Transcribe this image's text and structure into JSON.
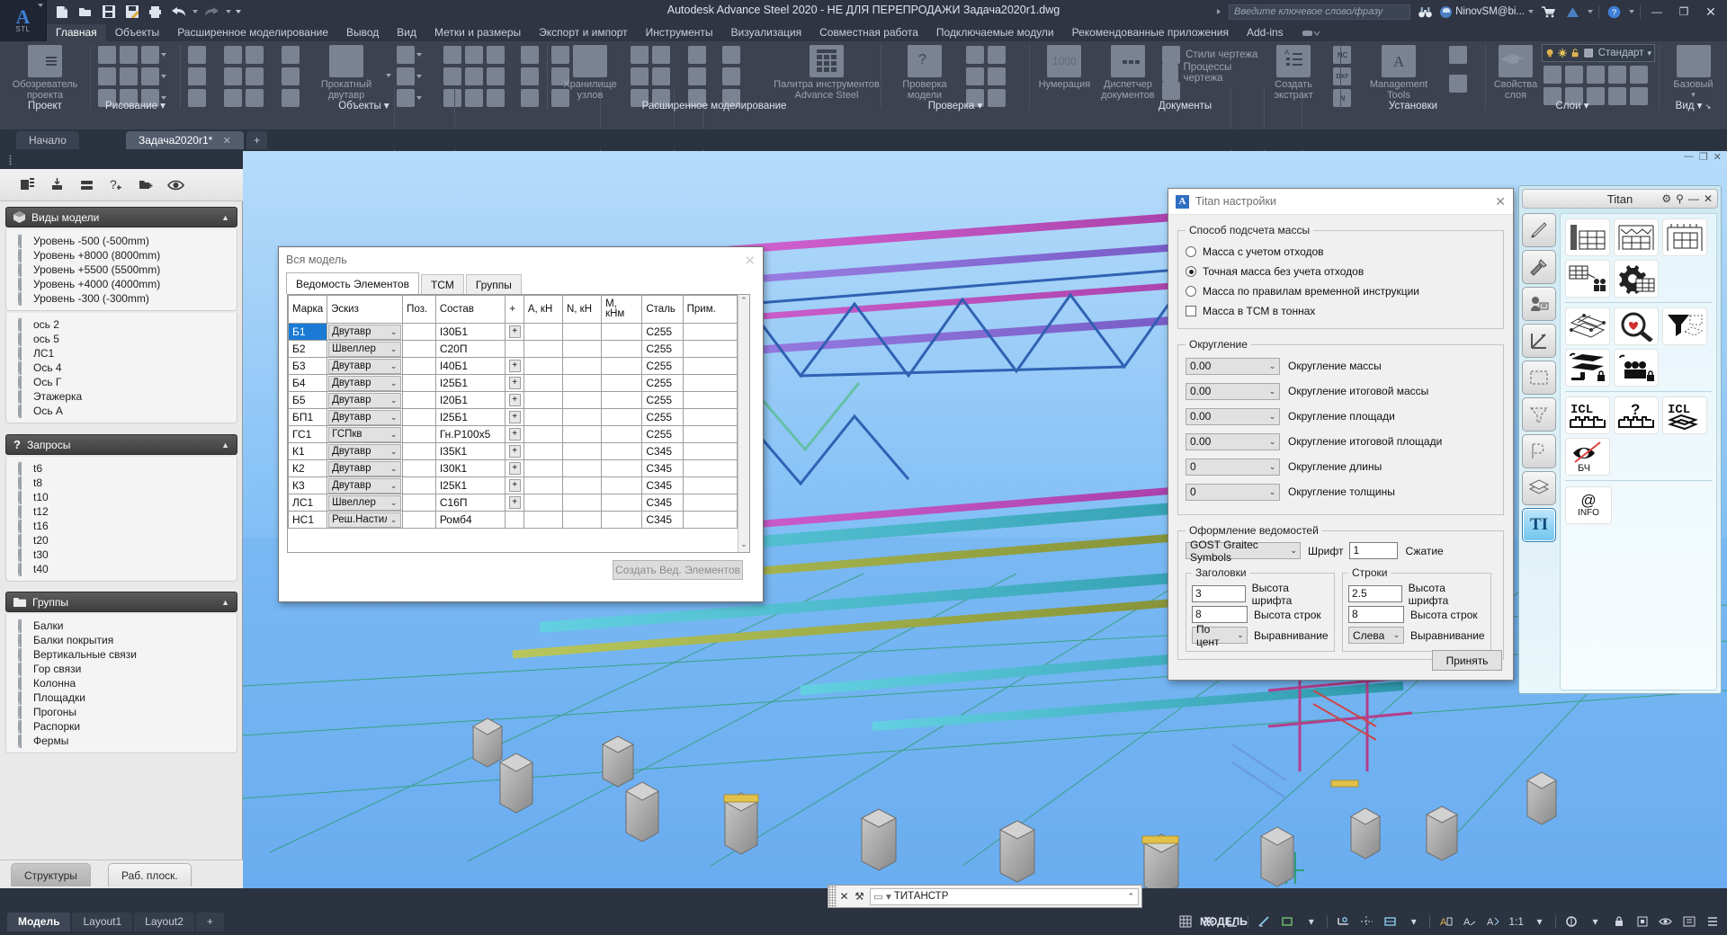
{
  "titlebar": {
    "app_title": "Autodesk Advance Steel 2020 - НЕ ДЛЯ ПЕРЕПРОДАЖИ    Задача2020r1.dwg",
    "app_button_label": "STL",
    "search_placeholder": "Введите ключевое слово/фразу",
    "user_name": "NinovSM@bi...",
    "quick_access": [
      {
        "name": "new-icon",
        "glyph": "🗋"
      },
      {
        "name": "open-icon",
        "glyph": "🗁"
      },
      {
        "name": "save-icon",
        "glyph": "🖫"
      },
      {
        "name": "save-as-icon",
        "glyph": "🖫"
      },
      {
        "name": "plot-icon",
        "glyph": "🖶"
      },
      {
        "name": "undo-icon",
        "glyph": "↰"
      },
      {
        "name": "redo-icon",
        "glyph": "↱"
      }
    ],
    "window_buttons": {
      "minimize": "—",
      "restore": "❐",
      "close": "✕"
    },
    "help_glyph": "?",
    "cart_glyph": "🛒"
  },
  "ribbon": {
    "tabs": [
      {
        "label": "Главная",
        "active": true
      },
      {
        "label": "Объекты",
        "active": false
      },
      {
        "label": "Расширенное моделирование",
        "active": false
      },
      {
        "label": "Вывод",
        "active": false
      },
      {
        "label": "Вид",
        "active": false
      },
      {
        "label": "Метки и размеры",
        "active": false
      },
      {
        "label": "Экспорт и импорт",
        "active": false
      },
      {
        "label": "Инструменты",
        "active": false
      },
      {
        "label": "Визуализация",
        "active": false
      },
      {
        "label": "Совместная работа",
        "active": false
      },
      {
        "label": "Подключаемые модули",
        "active": false
      },
      {
        "label": "Рекомендованные приложения",
        "active": false
      },
      {
        "label": "Add-ins",
        "active": false
      }
    ],
    "panels": [
      {
        "name": "Проект",
        "big_label": "Обозреватель\nпроекта"
      },
      {
        "name": "Рисование",
        "big_label": ""
      },
      {
        "name": "Объекты",
        "big_label": "Прокатный\nдвутавр"
      },
      {
        "name": "Расширенное моделирование",
        "big_label1": "Хранилище\nузлов",
        "big_label2": "Палитра инструментов\nAdvance Steel"
      },
      {
        "name": "Проверка",
        "big_label": "Проверка\nмодели"
      },
      {
        "name": "Документы",
        "big_label1": "Нумерация",
        "big_label2": "Диспетчер\nдокументов",
        "big_label3": "Создать\nэкстракт",
        "items": [
          "Стили чертежа",
          "Процессы чертежа"
        ],
        "numeration_value": "1000"
      },
      {
        "name": "Установки",
        "big_label": "Management\nTools"
      },
      {
        "name": "Слои",
        "big_label": "Свойства\nслоя",
        "layer_name": "Стандарт"
      },
      {
        "name": "Вид",
        "big_label": "Базовый"
      }
    ],
    "nc_labels": [
      "NC",
      "DXF",
      "N"
    ]
  },
  "file_tabs": [
    {
      "label": "Начало",
      "active": false,
      "closable": false
    },
    {
      "label": "Задача2020r1*",
      "active": true,
      "closable": true
    },
    {
      "label": "+",
      "active": false,
      "closable": false
    }
  ],
  "left_panel": {
    "toolbar_icons": [
      "list-icon",
      "add-model-view-icon",
      "layers-icon",
      "query-add-icon",
      "folder-add-icon",
      "visibility-icon"
    ],
    "groups": [
      {
        "title": "Виды модели",
        "icon": "cube-icon",
        "collapsed": false,
        "sections": [
          {
            "items": [
              "Уровень -500 (-500mm)",
              "Уровень +8000 (8000mm)",
              "Уровень +5500 (5500mm)",
              "Уровень +4000 (4000mm)",
              "Уровень -300 (-300mm)"
            ]
          },
          {
            "items": [
              "ось 2",
              "ось 5",
              "ЛС1",
              "Ось 4",
              "Ось Г",
              "Этажерка",
              "Ось А"
            ]
          }
        ]
      },
      {
        "title": "Запросы",
        "icon": "question-icon",
        "collapsed": false,
        "sections": [
          {
            "items": [
              "t6",
              "t8",
              "t10",
              "t12",
              "t16",
              "t20",
              "t30",
              "t40"
            ]
          }
        ]
      },
      {
        "title": "Группы",
        "icon": "folder-icon",
        "collapsed": false,
        "sections": [
          {
            "items": [
              "Балки",
              "Балки покрытия",
              "Вертикальные связи",
              "Гор связи",
              "Колонна",
              "Площадки",
              "Прогоны",
              "Распорки",
              "Фермы"
            ]
          }
        ]
      }
    ],
    "bottom_tabs": [
      {
        "label": "Структуры",
        "selected": true
      },
      {
        "label": "Раб. плоск.",
        "selected": false
      }
    ]
  },
  "table_dialog": {
    "title": "Вся модель",
    "close_glyph": "✕",
    "tabs": [
      {
        "label": "Ведомость Элементов",
        "selected": true
      },
      {
        "label": "ТСМ",
        "selected": false
      },
      {
        "label": "Группы",
        "selected": false
      }
    ],
    "columns": [
      "Марка",
      "Эскиз",
      "Поз.",
      "Состав",
      "+",
      "A, кН",
      "N, кН",
      "M, кНм",
      "Сталь",
      "Прим."
    ],
    "rows": [
      {
        "marka": "Б1",
        "eskiz": "Двутавр",
        "poz": "",
        "sostav": "I30Б1",
        "plus": "+",
        "a": "",
        "n": "",
        "m": "",
        "stal": "C255",
        "prim": "",
        "selected": true
      },
      {
        "marka": "Б2",
        "eskiz": "Швеллер",
        "poz": "",
        "sostav": "C20П",
        "plus": "",
        "a": "",
        "n": "",
        "m": "",
        "stal": "C255",
        "prim": "",
        "selected": false
      },
      {
        "marka": "Б3",
        "eskiz": "Двутавр",
        "poz": "",
        "sostav": "I40Б1",
        "plus": "+",
        "a": "",
        "n": "",
        "m": "",
        "stal": "C255",
        "prim": "",
        "selected": false
      },
      {
        "marka": "Б4",
        "eskiz": "Двутавр",
        "poz": "",
        "sostav": "I25Б1",
        "plus": "+",
        "a": "",
        "n": "",
        "m": "",
        "stal": "C255",
        "prim": "",
        "selected": false
      },
      {
        "marka": "Б5",
        "eskiz": "Двутавр",
        "poz": "",
        "sostav": "I20Б1",
        "plus": "+",
        "a": "",
        "n": "",
        "m": "",
        "stal": "C255",
        "prim": "",
        "selected": false
      },
      {
        "marka": "БП1",
        "eskiz": "Двутавр",
        "poz": "",
        "sostav": "I25Б1",
        "plus": "+",
        "a": "",
        "n": "",
        "m": "",
        "stal": "C255",
        "prim": "",
        "selected": false
      },
      {
        "marka": "ГС1",
        "eskiz": "ГСПкв",
        "poz": "",
        "sostav": "Гн.Р100x5",
        "plus": "+",
        "a": "",
        "n": "",
        "m": "",
        "stal": "C255",
        "prim": "",
        "selected": false
      },
      {
        "marka": "К1",
        "eskiz": "Двутавр",
        "poz": "",
        "sostav": "I35К1",
        "plus": "+",
        "a": "",
        "n": "",
        "m": "",
        "stal": "C345",
        "prim": "",
        "selected": false
      },
      {
        "marka": "К2",
        "eskiz": "Двутавр",
        "poz": "",
        "sostav": "I30К1",
        "plus": "+",
        "a": "",
        "n": "",
        "m": "",
        "stal": "C345",
        "prim": "",
        "selected": false
      },
      {
        "marka": "К3",
        "eskiz": "Двутавр",
        "poz": "",
        "sostav": "I25К1",
        "plus": "+",
        "a": "",
        "n": "",
        "m": "",
        "stal": "C345",
        "prim": "",
        "selected": false
      },
      {
        "marka": "ЛС1",
        "eskiz": "Швеллер",
        "poz": "",
        "sostav": "C16П",
        "plus": "+",
        "a": "",
        "n": "",
        "m": "",
        "stal": "C345",
        "prim": "",
        "selected": false
      },
      {
        "marka": "НС1",
        "eskiz": "Реш.Настил",
        "poz": "",
        "sostav": "Ромб4",
        "plus": "",
        "a": "",
        "n": "",
        "m": "",
        "stal": "C345",
        "prim": "",
        "selected": false
      }
    ],
    "create_button": "Создать Вед. Элементов"
  },
  "titan_settings": {
    "title": "Titan настройки",
    "close_glyph": "✕",
    "mass_group": {
      "legend": "Способ подсчета массы",
      "options": [
        {
          "label": "Масса с учетом отходов",
          "selected": false
        },
        {
          "label": "Точная масса без учета отходов",
          "selected": true
        },
        {
          "label": "Масса по правилам временной инструкции",
          "selected": false
        }
      ],
      "checkbox": {
        "label": "Масса в ТСМ в тоннах",
        "checked": false
      }
    },
    "rounding_group": {
      "legend": "Округление",
      "rows": [
        {
          "value": "0.00",
          "label": "Округление массы"
        },
        {
          "value": "0.00",
          "label": "Округление итоговой массы"
        },
        {
          "value": "0.00",
          "label": "Округление площади"
        },
        {
          "value": "0.00",
          "label": "Округление итоговой площади"
        },
        {
          "value": "0",
          "label": "Округление длины"
        },
        {
          "value": "0",
          "label": "Округление толщины"
        }
      ]
    },
    "format_group": {
      "legend": "Оформление ведомостей",
      "font_select": "GOST Graitec Symbols",
      "font_label": "Шрифт",
      "font_value": "1",
      "compression_label": "Сжатие",
      "headers": {
        "legend": "Заголовки",
        "font_height": {
          "value": "3",
          "label": "Высота шрифта"
        },
        "row_height": {
          "value": "8",
          "label": "Высота строк"
        },
        "align": {
          "value": "По цент",
          "label": "Выравнивание"
        }
      },
      "rows": {
        "legend": "Строки",
        "font_height": {
          "value": "2.5",
          "label": "Высота шрифта"
        },
        "row_height": {
          "value": "8",
          "label": "Высота строк"
        },
        "align": {
          "value": "Слева",
          "label": "Выравнивание"
        }
      }
    },
    "accept_button": "Принять"
  },
  "titan_palette": {
    "title": "Titan",
    "header_icons": [
      "gear-icon",
      "pin-icon",
      "minimize-icon",
      "close-icon"
    ],
    "side_buttons": [
      {
        "name": "pencil-icon",
        "selected": false
      },
      {
        "name": "tools-icon",
        "selected": false
      },
      {
        "name": "user-card-icon",
        "selected": false
      },
      {
        "name": "axes-icon",
        "selected": false
      },
      {
        "name": "select-region-icon",
        "selected": false
      },
      {
        "name": "filter-icon",
        "selected": false
      },
      {
        "name": "fold-icon",
        "selected": false
      },
      {
        "name": "plates-icon",
        "selected": false
      },
      {
        "name": "titan-icon",
        "selected": true
      }
    ],
    "tool_groups": [
      [
        "column-table-icon",
        "frame-table-icon",
        "portal-table-icon",
        "weld-table-icon",
        "gear-table-icon"
      ],
      [
        "mesh-icon",
        "search-heart-icon",
        "funnel-icon",
        "beam-lock-icon",
        "bolt-lock-icon"
      ],
      [
        "icl-parts-icon",
        "icl-question-icon",
        "icl-layers-icon",
        "eye-bch-icon"
      ]
    ],
    "info_button": {
      "icon": "at-icon",
      "label": "INFO"
    },
    "bch_label": "БЧ",
    "icl_label": "ICL"
  },
  "command_line": {
    "close_glyph": "✕",
    "wrench_glyph": "⚒",
    "value": "ТИТАНСТР",
    "prefix_glyph": "▭"
  },
  "bottom": {
    "layout_tabs": [
      {
        "label": "Модель",
        "active": true
      },
      {
        "label": "Layout1",
        "active": false
      },
      {
        "label": "Layout2",
        "active": false
      },
      {
        "label": "+",
        "active": false
      }
    ],
    "model_label": "МОДЕЛЬ",
    "scale": "1:1",
    "status_icons": [
      "grid-icon",
      "snap-icon",
      "ortho-icon",
      "polar-icon",
      "osnap-icon",
      "otrack-icon",
      "lineweight-icon",
      "transparency-icon",
      "selection-cycling-icon",
      "annotation-icon",
      "workspace-icon",
      "hardware-icon",
      "clean-screen-icon",
      "customization-icon"
    ]
  },
  "colors": {
    "accent": "#1b7bd4",
    "ribbon_bg": "#3c4250",
    "title_bg": "#2f3542",
    "viewport_top": "#b6dcfa",
    "viewport_bottom": "#6fb2f2",
    "member_magenta": "#c04fc0",
    "member_purple": "#8b6fd8",
    "member_olive": "#9aa84a",
    "member_cyan": "#3fb8cc",
    "member_green": "#2fa05a",
    "member_red": "#d04545",
    "concrete": "#9e9e9e"
  }
}
